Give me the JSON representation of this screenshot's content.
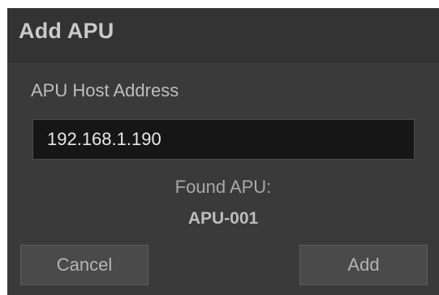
{
  "dialog": {
    "title": "Add APU",
    "host_field": {
      "label": "APU Host Address",
      "value": "192.168.1.190"
    },
    "found": {
      "label": "Found APU:",
      "value": "APU-001"
    },
    "buttons": {
      "cancel_label": "Cancel",
      "add_label": "Add"
    }
  },
  "colors": {
    "dialog_bg": "#3a3a3a",
    "header_bg": "#333333",
    "input_bg": "#161616",
    "button_bg": "#4a4a4a"
  }
}
